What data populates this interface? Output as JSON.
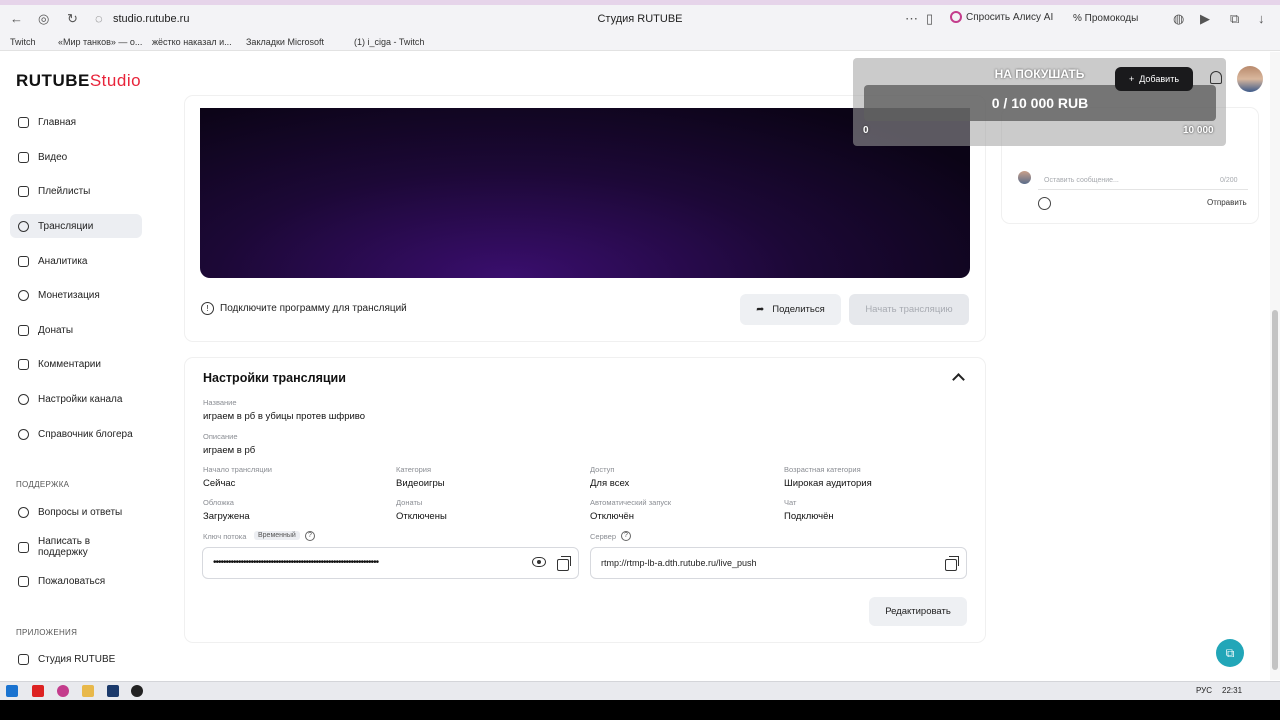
{
  "browser": {
    "url": "studio.rutube.ru",
    "title": "Студия RUTUBE",
    "alice_label": "Спросить Алису AI",
    "promo_label": "Промокоды",
    "bookmarks": [
      "Twitch",
      "«Мир танков» — о...",
      "жёстко наказал и...",
      "Закладки Microsoft",
      "(1) i_ciga - Twitch"
    ]
  },
  "logo": {
    "brand": "RUTUBE",
    "suffix": "Studio"
  },
  "sidebar": {
    "items": [
      {
        "label": "Главная",
        "icon": "home-icon"
      },
      {
        "label": "Видео",
        "icon": "video-icon"
      },
      {
        "label": "Плейлисты",
        "icon": "playlist-icon"
      },
      {
        "label": "Трансляции",
        "icon": "broadcast-icon",
        "active": true
      },
      {
        "label": "Аналитика",
        "icon": "analytics-icon"
      },
      {
        "label": "Монетизация",
        "icon": "monetization-icon"
      },
      {
        "label": "Донаты",
        "icon": "donate-icon"
      },
      {
        "label": "Комментарии",
        "icon": "comments-icon"
      },
      {
        "label": "Настройки канала",
        "icon": "settings-icon"
      },
      {
        "label": "Справочник блогера",
        "icon": "help-book-icon"
      }
    ],
    "support_label": "ПОДДЕРЖКА",
    "support_items": [
      {
        "label": "Вопросы и ответы",
        "icon": "faq-icon"
      },
      {
        "label": "Написать в поддержку",
        "icon": "mail-icon"
      },
      {
        "label": "Пожаловаться",
        "icon": "flag-icon"
      }
    ],
    "apps_label": "ПРИЛОЖЕНИЯ",
    "apps_items": [
      {
        "label": "Студия RUTUBE",
        "icon": "app-icon"
      }
    ]
  },
  "player": {
    "connect_text": "Подключите программу для трансляций",
    "share_label": "Поделиться",
    "start_label": "Начать трансляцию"
  },
  "settings": {
    "title": "Настройки трансляции",
    "name_label": "Название",
    "name_value": "играем в рб в убицы протев шфриво",
    "desc_label": "Описание",
    "desc_value": "играем в рб",
    "start_label": "Начало трансляции",
    "start_value": "Сейчас",
    "category_label": "Категория",
    "category_value": "Видеоигры",
    "access_label": "Доступ",
    "access_value": "Для всех",
    "age_label": "Возрастная категория",
    "age_value": "Широкая аудитория",
    "cover_label": "Обложка",
    "cover_value": "Загружена",
    "donations_label": "Донаты",
    "donations_value": "Отключены",
    "autostart_label": "Автоматический запуск",
    "autostart_value": "Отключён",
    "chat_label": "Чат",
    "chat_value": "Подключён",
    "key_label": "Ключ потока",
    "key_badge": "Временный",
    "key_value": "••••••••••••••••••••••••••••••••••••••••••••••••••••••••••••••••••",
    "server_label": "Сервер",
    "server_value": "rtmp://rtmp-lb-a.dth.rutube.ru/live_push",
    "edit_label": "Редактировать"
  },
  "chat": {
    "placeholder": "Оставить сообщение...",
    "count": "0/200",
    "send_label": "Отправить"
  },
  "donation_goal": {
    "title": "НА ПОКУШАТЬ",
    "progress_text": "0 / 10 000 RUB",
    "current": 0,
    "target": 10000,
    "min_label": "0",
    "max_label": "10 000",
    "fill_color": "#4caf50"
  },
  "header": {
    "add_label": "Добавить"
  },
  "taskbar": {
    "lang": "РУС",
    "time": "22:31"
  },
  "colors": {
    "accent": "#e8243a",
    "help_fab": "#22a6b8"
  }
}
